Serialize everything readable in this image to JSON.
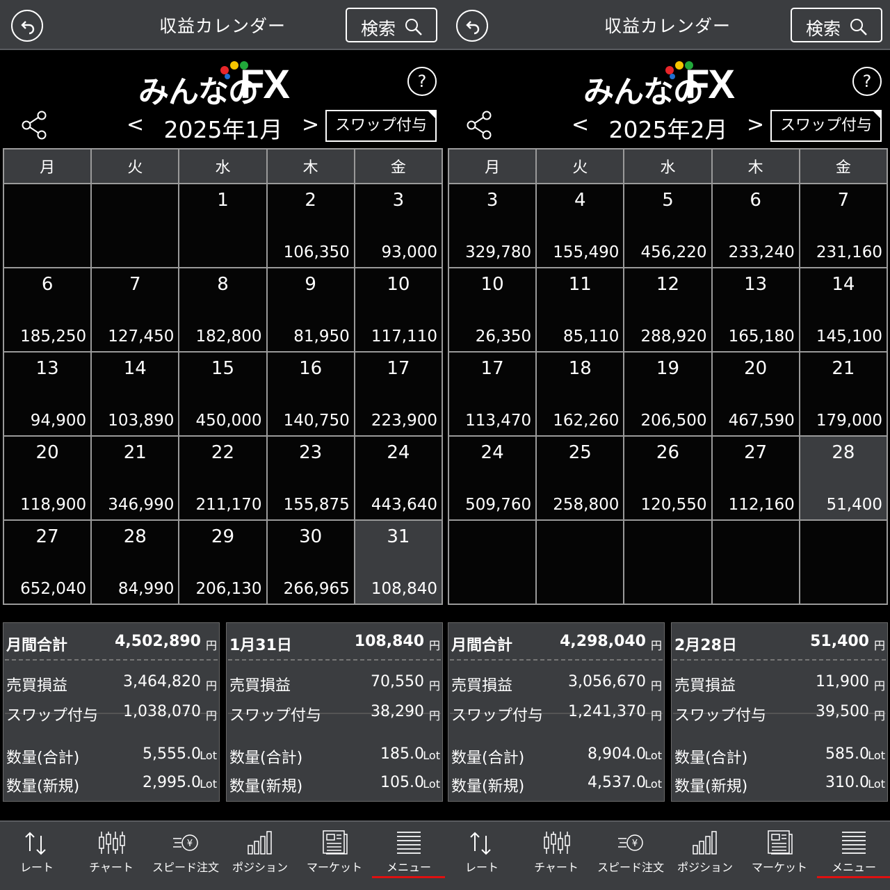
{
  "screens": [
    {
      "header": {
        "title": "収益カレンダー",
        "search_label": "検索"
      },
      "logo": {
        "text": "みんなの",
        "fx": "FX"
      },
      "help": "?",
      "nav": {
        "prev": "<",
        "month": "2025年1月",
        "next": ">",
        "swap_toggle": "スワップ付与"
      },
      "weekdays": [
        "月",
        "火",
        "水",
        "木",
        "金"
      ],
      "weeks": [
        [
          {
            "d": "",
            "v": ""
          },
          {
            "d": "",
            "v": ""
          },
          {
            "d": "1",
            "v": ""
          },
          {
            "d": "2",
            "v": "106,350"
          },
          {
            "d": "3",
            "v": "93,000"
          }
        ],
        [
          {
            "d": "6",
            "v": "185,250"
          },
          {
            "d": "7",
            "v": "127,450"
          },
          {
            "d": "8",
            "v": "182,800"
          },
          {
            "d": "9",
            "v": "81,950"
          },
          {
            "d": "10",
            "v": "117,110"
          }
        ],
        [
          {
            "d": "13",
            "v": "94,900"
          },
          {
            "d": "14",
            "v": "103,890"
          },
          {
            "d": "15",
            "v": "450,000"
          },
          {
            "d": "16",
            "v": "140,750"
          },
          {
            "d": "17",
            "v": "223,900"
          }
        ],
        [
          {
            "d": "20",
            "v": "118,900"
          },
          {
            "d": "21",
            "v": "346,990"
          },
          {
            "d": "22",
            "v": "211,170"
          },
          {
            "d": "23",
            "v": "155,875"
          },
          {
            "d": "24",
            "v": "443,640"
          }
        ],
        [
          {
            "d": "27",
            "v": "652,040"
          },
          {
            "d": "28",
            "v": "84,990"
          },
          {
            "d": "29",
            "v": "206,130"
          },
          {
            "d": "30",
            "v": "266,965"
          },
          {
            "d": "31",
            "v": "108,840",
            "selected": true
          }
        ]
      ],
      "summary": {
        "monthly": {
          "title": "月間合計",
          "total": "4,502,890",
          "unit": "円",
          "rows": [
            {
              "label": "売買損益",
              "value": "3,464,820",
              "unit": "円"
            },
            {
              "label": "スワップ付与",
              "value": "1,038,070",
              "unit": "円"
            },
            {
              "label": "数量(合計)",
              "value": "5,555.0",
              "unit": "Lot"
            },
            {
              "label": "数量(新規)",
              "value": "2,995.0",
              "unit": "Lot"
            }
          ]
        },
        "daily": {
          "title": "1月31日",
          "total": "108,840",
          "unit": "円",
          "rows": [
            {
              "label": "売買損益",
              "value": "70,550",
              "unit": "円"
            },
            {
              "label": "スワップ付与",
              "value": "38,290",
              "unit": "円"
            },
            {
              "label": "数量(合計)",
              "value": "185.0",
              "unit": "Lot"
            },
            {
              "label": "数量(新規)",
              "value": "105.0",
              "unit": "Lot"
            }
          ]
        }
      },
      "tabs": [
        {
          "label": "レート",
          "icon": "rate-arrows-icon"
        },
        {
          "label": "チャート",
          "icon": "candlestick-icon"
        },
        {
          "label": "スピード注文",
          "icon": "speed-order-icon"
        },
        {
          "label": "ポジション",
          "icon": "bar-chart-icon"
        },
        {
          "label": "マーケット",
          "icon": "newspaper-icon"
        },
        {
          "label": "メニュー",
          "icon": "menu-list-icon",
          "active": true
        }
      ]
    },
    {
      "header": {
        "title": "収益カレンダー",
        "search_label": "検索"
      },
      "logo": {
        "text": "みんなの",
        "fx": "FX"
      },
      "help": "?",
      "nav": {
        "prev": "<",
        "month": "2025年2月",
        "next": ">",
        "swap_toggle": "スワップ付与"
      },
      "weekdays": [
        "月",
        "火",
        "水",
        "木",
        "金"
      ],
      "weeks": [
        [
          {
            "d": "3",
            "v": "329,780"
          },
          {
            "d": "4",
            "v": "155,490"
          },
          {
            "d": "5",
            "v": "456,220"
          },
          {
            "d": "6",
            "v": "233,240"
          },
          {
            "d": "7",
            "v": "231,160"
          }
        ],
        [
          {
            "d": "10",
            "v": "26,350"
          },
          {
            "d": "11",
            "v": "85,110"
          },
          {
            "d": "12",
            "v": "288,920"
          },
          {
            "d": "13",
            "v": "165,180"
          },
          {
            "d": "14",
            "v": "145,100"
          }
        ],
        [
          {
            "d": "17",
            "v": "113,470"
          },
          {
            "d": "18",
            "v": "162,260"
          },
          {
            "d": "19",
            "v": "206,500"
          },
          {
            "d": "20",
            "v": "467,590"
          },
          {
            "d": "21",
            "v": "179,000"
          }
        ],
        [
          {
            "d": "24",
            "v": "509,760"
          },
          {
            "d": "25",
            "v": "258,800"
          },
          {
            "d": "26",
            "v": "120,550"
          },
          {
            "d": "27",
            "v": "112,160"
          },
          {
            "d": "28",
            "v": "51,400",
            "selected": true
          }
        ],
        [
          {
            "d": "",
            "v": ""
          },
          {
            "d": "",
            "v": ""
          },
          {
            "d": "",
            "v": ""
          },
          {
            "d": "",
            "v": ""
          },
          {
            "d": "",
            "v": ""
          }
        ]
      ],
      "summary": {
        "monthly": {
          "title": "月間合計",
          "total": "4,298,040",
          "unit": "円",
          "rows": [
            {
              "label": "売買損益",
              "value": "3,056,670",
              "unit": "円"
            },
            {
              "label": "スワップ付与",
              "value": "1,241,370",
              "unit": "円"
            },
            {
              "label": "数量(合計)",
              "value": "8,904.0",
              "unit": "Lot"
            },
            {
              "label": "数量(新規)",
              "value": "4,537.0",
              "unit": "Lot"
            }
          ]
        },
        "daily": {
          "title": "2月28日",
          "total": "51,400",
          "unit": "円",
          "rows": [
            {
              "label": "売買損益",
              "value": "11,900",
              "unit": "円"
            },
            {
              "label": "スワップ付与",
              "value": "39,500",
              "unit": "円"
            },
            {
              "label": "数量(合計)",
              "value": "585.0",
              "unit": "Lot"
            },
            {
              "label": "数量(新規)",
              "value": "310.0",
              "unit": "Lot"
            }
          ]
        }
      },
      "tabs": [
        {
          "label": "レート",
          "icon": "rate-arrows-icon"
        },
        {
          "label": "チャート",
          "icon": "candlestick-icon"
        },
        {
          "label": "スピード注文",
          "icon": "speed-order-icon"
        },
        {
          "label": "ポジション",
          "icon": "bar-chart-icon"
        },
        {
          "label": "マーケット",
          "icon": "newspaper-icon"
        },
        {
          "label": "メニュー",
          "icon": "menu-list-icon",
          "active": true
        }
      ]
    }
  ],
  "colors": {
    "accent_red": "#e01010",
    "panel_gray": "#3b3d40",
    "logo_dot_red": "#e8262a",
    "logo_dot_yellow": "#f5c400",
    "logo_dot_green": "#21a83a",
    "logo_dot_blue": "#1f6fd1"
  }
}
